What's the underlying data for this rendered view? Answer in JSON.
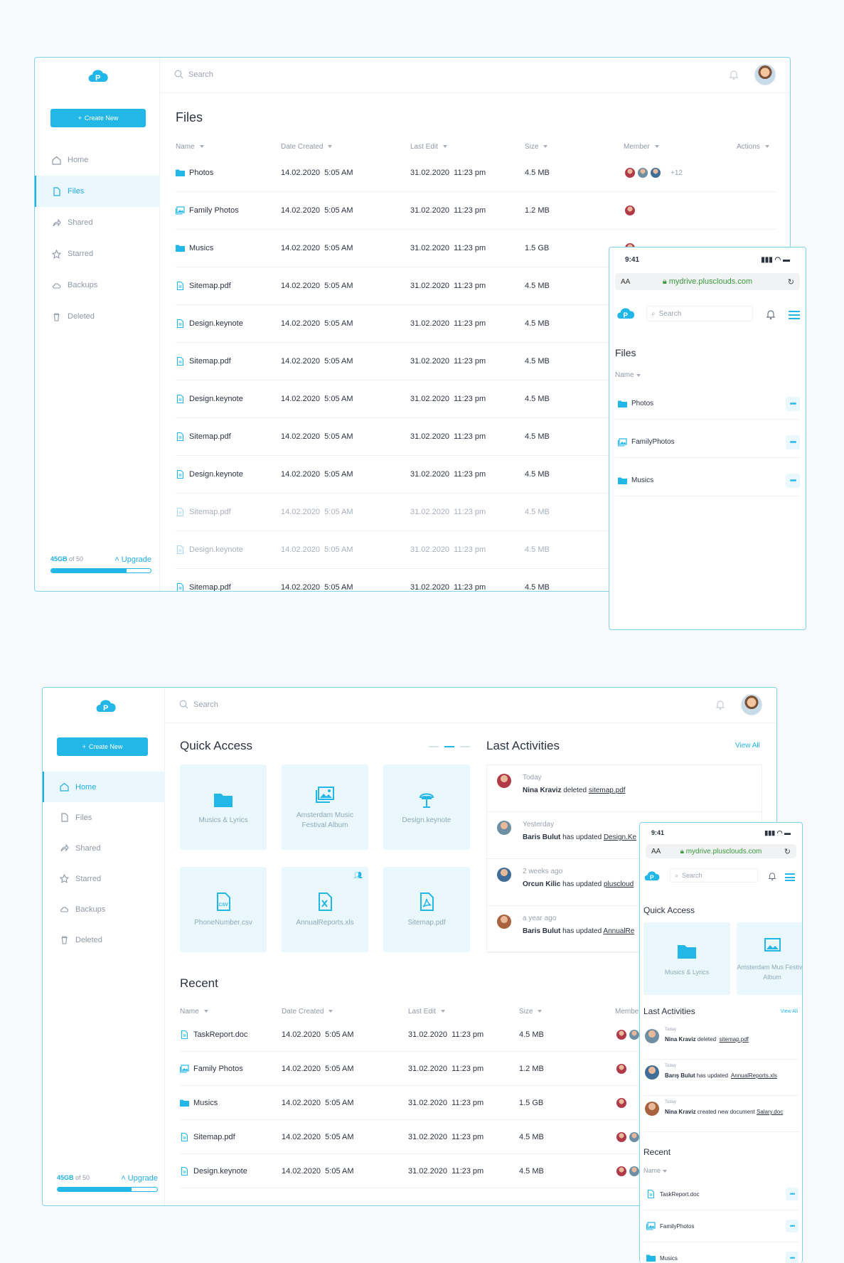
{
  "brand": {
    "accent": "#22b7e6",
    "border": "#7fd3ee",
    "danger": "#e76a6a",
    "star": "#1eaee0"
  },
  "desktop1": {
    "create_label": "Create New",
    "search_placeholder": "Search",
    "nav": [
      {
        "label": "Home",
        "icon": "home-icon"
      },
      {
        "label": "Files",
        "icon": "file-icon",
        "active": true
      },
      {
        "label": "Shared",
        "icon": "share-icon"
      },
      {
        "label": "Starred",
        "icon": "star-icon"
      },
      {
        "label": "Backups",
        "icon": "cloud-icon"
      },
      {
        "label": "Deleted",
        "icon": "trash-icon"
      }
    ],
    "storage": {
      "used": "45GB",
      "of": "of 50",
      "upgrade": "Upgrade",
      "fill": 0.76
    },
    "title": "Files",
    "columns": {
      "name": "Name",
      "created": "Date Created",
      "edit": "Last Edit",
      "size": "Size",
      "member": "Member",
      "actions": "Actions"
    },
    "rows": [
      {
        "name": "Photos",
        "type": "folder",
        "created": "14.02.2020  5:05 AM",
        "edit": "31.02.2020  11:23 pm",
        "size": "4.5 MB",
        "members": 3,
        "more": "+12",
        "starred": false
      },
      {
        "name": "Family Photos",
        "type": "album",
        "created": "14.02.2020  5:05 AM",
        "edit": "31.02.2020  11:23 pm",
        "size": "1.2 MB",
        "members": 1,
        "more": "",
        "starred": true
      },
      {
        "name": "Musics",
        "type": "folder",
        "created": "14.02.2020  5:05 AM",
        "edit": "31.02.2020  11:23 pm",
        "size": "1.5 GB",
        "members": 1,
        "more": "",
        "starred": false
      },
      {
        "name": "Sitemap.pdf",
        "type": "file",
        "created": "14.02.2020  5:05 AM",
        "edit": "31.02.2020  11:23 pm",
        "size": "4.5 MB"
      },
      {
        "name": "Design.keynote",
        "type": "file",
        "created": "14.02.2020  5:05 AM",
        "edit": "31.02.2020  11:23 pm",
        "size": "4.5 MB"
      },
      {
        "name": "Sitemap.pdf",
        "type": "file",
        "created": "14.02.2020  5:05 AM",
        "edit": "31.02.2020  11:23 pm",
        "size": "4.5 MB"
      },
      {
        "name": "Design.keynote",
        "type": "file",
        "created": "14.02.2020  5:05 AM",
        "edit": "31.02.2020  11:23 pm",
        "size": "4.5 MB"
      },
      {
        "name": "Sitemap.pdf",
        "type": "file",
        "created": "14.02.2020  5:05 AM",
        "edit": "31.02.2020  11:23 pm",
        "size": "4.5 MB"
      },
      {
        "name": "Design.keynote",
        "type": "file",
        "created": "14.02.2020  5:05 AM",
        "edit": "31.02.2020  11:23 pm",
        "size": "4.5 MB"
      },
      {
        "name": "Sitemap.pdf",
        "type": "file",
        "created": "14.02.2020  5:05 AM",
        "edit": "31.02.2020  11:23 pm",
        "size": "4.5 MB",
        "faded": true
      },
      {
        "name": "Design.keynote",
        "type": "file",
        "created": "14.02.2020  5:05 AM",
        "edit": "31.02.2020  11:23 pm",
        "size": "4.5 MB",
        "faded": true
      },
      {
        "name": "Sitemap.pdf",
        "type": "file",
        "created": "14.02.2020  5:05 AM",
        "edit": "31.02.2020  11:23 pm",
        "size": "4.5 MB"
      }
    ]
  },
  "mobile1": {
    "time": "9:41",
    "url": "mydrive.plusclouds.com",
    "aa": "AA",
    "search_placeholder": "Search",
    "title": "Files",
    "name_col": "Name",
    "rows": [
      {
        "name": "Photos",
        "type": "folder"
      },
      {
        "name": "FamilyPhotos",
        "type": "album"
      },
      {
        "name": "Musics",
        "type": "folder"
      }
    ]
  },
  "desktop2": {
    "create_label": "Create New",
    "search_placeholder": "Search",
    "nav": [
      {
        "label": "Home",
        "icon": "home-icon",
        "active": true
      },
      {
        "label": "Files",
        "icon": "file-icon"
      },
      {
        "label": "Shared",
        "icon": "share-icon"
      },
      {
        "label": "Starred",
        "icon": "star-icon"
      },
      {
        "label": "Backups",
        "icon": "cloud-icon"
      },
      {
        "label": "Deleted",
        "icon": "trash-icon"
      }
    ],
    "storage": {
      "used": "45GB",
      "of": "of 50",
      "upgrade": "Upgrade",
      "fill": 0.74
    },
    "quick_title": "Quick Access",
    "quick": [
      {
        "label": "Musics & Lyrics",
        "icon": "folder-icon"
      },
      {
        "label": "Amsterdam Music Festival Album",
        "icon": "album-icon"
      },
      {
        "label": "Design.keynote",
        "icon": "keynote-icon"
      },
      {
        "label": "PhoneNumber.csv",
        "icon": "csv-icon"
      },
      {
        "label": "AnnualReports.xls",
        "icon": "xls-icon",
        "shared": true
      },
      {
        "label": "Sitemap.pdf",
        "icon": "pdf-icon"
      }
    ],
    "activities_title": "Last Activities",
    "view_all": "View All",
    "activities": [
      {
        "time": "Today",
        "user": "Nina Kraviz",
        "action": " deleted ",
        "target": "sitemap.pdf"
      },
      {
        "time": "Yesterday",
        "user": "Baris Bulut",
        "action": " has updated ",
        "target": "Design.Ke"
      },
      {
        "time": "2 weeks ago",
        "user": "Orcun Kilic",
        "action": " has updated ",
        "target": "pluscloud"
      },
      {
        "time": "a year ago",
        "user": "Baris Bulut",
        "action": " has updated ",
        "target": "AnnualRe"
      }
    ],
    "recent_title": "Recent",
    "columns": {
      "name": "Name",
      "created": "Date Created",
      "edit": "Last Edit",
      "size": "Size",
      "member": "Membe"
    },
    "rows": [
      {
        "name": "TaskReport.doc",
        "type": "file",
        "created": "14.02.2020  5:05 AM",
        "edit": "31.02.2020  11:23 pm",
        "size": "4.5 MB",
        "members": 2
      },
      {
        "name": "Family Photos",
        "type": "album",
        "created": "14.02.2020  5:05 AM",
        "edit": "31.02.2020  11:23 pm",
        "size": "1.2 MB",
        "members": 1
      },
      {
        "name": "Musics",
        "type": "folder",
        "created": "14.02.2020  5:05 AM",
        "edit": "31.02.2020  11:23 pm",
        "size": "1.5 GB",
        "members": 1
      },
      {
        "name": "Sitemap.pdf",
        "type": "file",
        "created": "14.02.2020  5:05 AM",
        "edit": "31.02.2020  11:23 pm",
        "size": "4.5 MB",
        "members": 2
      },
      {
        "name": "Design.keynote",
        "type": "file",
        "created": "14.02.2020  5:05 AM",
        "edit": "31.02.2020  11:23 pm",
        "size": "4.5 MB",
        "members": 2
      }
    ]
  },
  "mobile2": {
    "time": "9:41",
    "url": "mydrive.plusclouds.com",
    "aa": "AA",
    "search_placeholder": "Search",
    "quick_title": "Quick Access",
    "quick": [
      {
        "label": "Musics & Lyrics"
      },
      {
        "label": "Amsterdam Mus Festival Album"
      }
    ],
    "activities_title": "Last Activities",
    "view_all": "View All",
    "activities": [
      {
        "time": "Today",
        "user": "Nina Kraviz",
        "action": " deleted ",
        "target": "sitemap.pdf"
      },
      {
        "time": "Today",
        "user": "Barış Bulut",
        "action": " has updated ",
        "target": "AnnualReports.xls"
      },
      {
        "time": "Today",
        "user": "Nina Kraviz",
        "action": " created new document",
        "target": "Salary.doc"
      }
    ],
    "recent_title": "Recent",
    "name_col": "Name",
    "rows": [
      {
        "name": "TaskReport.doc"
      },
      {
        "name": "FamilyPhotos"
      },
      {
        "name": "Musics"
      }
    ]
  }
}
